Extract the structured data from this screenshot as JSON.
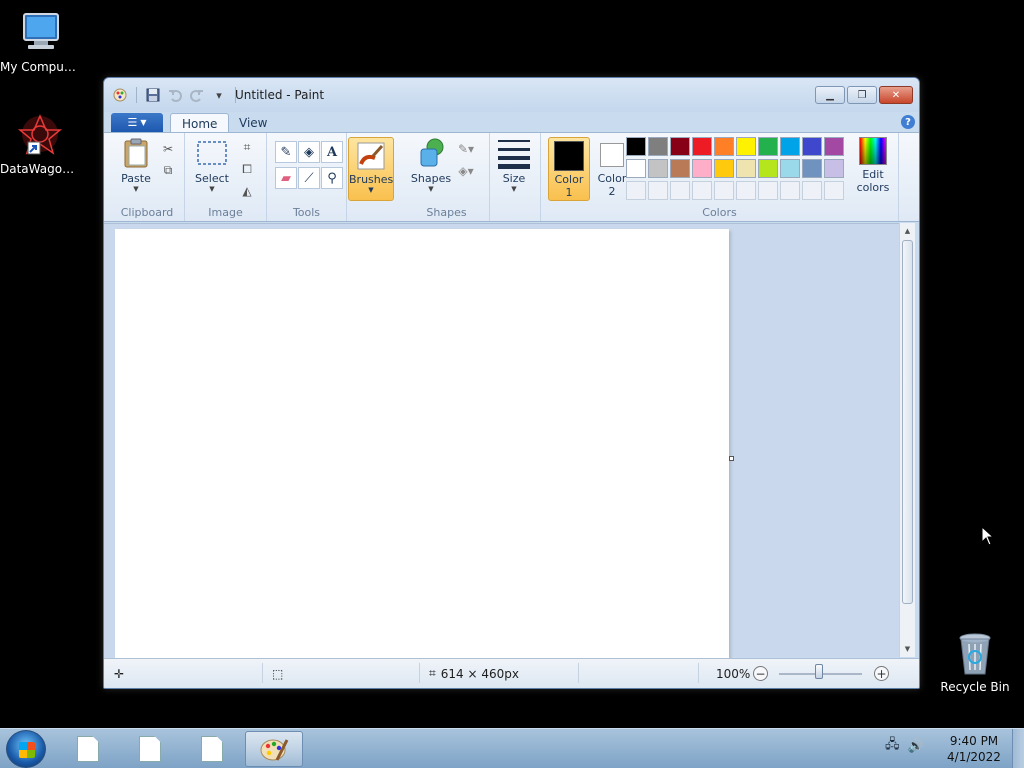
{
  "desktop": {
    "icons": [
      {
        "label": "My Computer"
      },
      {
        "label": "DataWagon..."
      },
      {
        "label": "Recycle Bin"
      }
    ]
  },
  "window": {
    "title": "Untitled - Paint",
    "tabs": [
      {
        "label": "Home",
        "active": true
      },
      {
        "label": "View",
        "active": false
      }
    ],
    "ribbon": {
      "clipboard": {
        "group_label": "Clipboard",
        "paste_label": "Paste"
      },
      "image": {
        "group_label": "Image",
        "select_label": "Select"
      },
      "tools": {
        "group_label": "Tools"
      },
      "brushes": {
        "label": "Brushes"
      },
      "shapes": {
        "group_label": "Shapes",
        "shapes_label": "Shapes"
      },
      "size": {
        "label": "Size"
      },
      "colors": {
        "group_label": "Colors",
        "color1_line1": "Color",
        "color1_line2": "1",
        "color2_line1": "Color",
        "color2_line2": "2",
        "color1_value": "#000000",
        "color2_value": "#ffffff",
        "edit_line1": "Edit",
        "edit_line2": "colors",
        "palette_row1": [
          "#000000",
          "#7f7f7f",
          "#880015",
          "#ed1c24",
          "#ff7f27",
          "#fff200",
          "#22b14c",
          "#00a2e8",
          "#3f48cc",
          "#a349a4"
        ],
        "palette_row2": [
          "#ffffff",
          "#c3c3c3",
          "#b97a57",
          "#ffaec9",
          "#ffc90e",
          "#efe4b0",
          "#b5e61d",
          "#99d9ea",
          "#7092be",
          "#c8bfe7"
        ]
      }
    },
    "statusbar": {
      "dimensions": "614 × 460px",
      "zoom": "100%"
    }
  },
  "taskbar": {
    "time": "9:40 PM",
    "date": "4/1/2022"
  }
}
